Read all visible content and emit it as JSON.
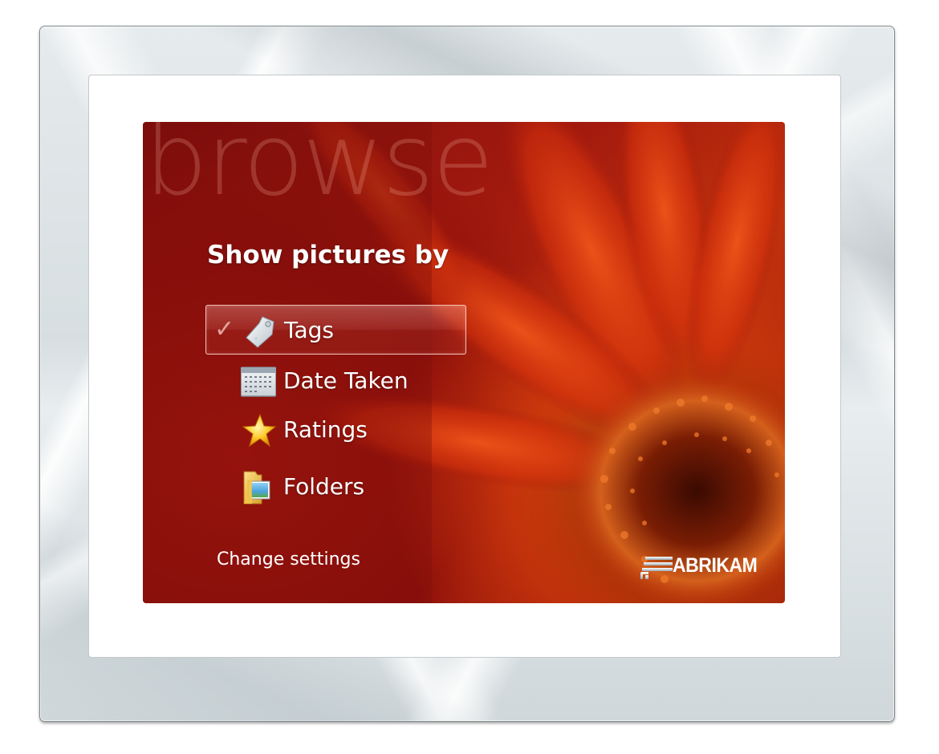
{
  "screen": {
    "watermark": "browse",
    "heading": "Show pictures by"
  },
  "menu": {
    "items": [
      {
        "label": "Tags",
        "icon": "tag-icon",
        "selected": true,
        "check": "✓"
      },
      {
        "label": "Date Taken",
        "icon": "calendar-icon",
        "selected": false
      },
      {
        "label": "Ratings",
        "icon": "star-icon",
        "selected": false
      },
      {
        "label": "Folders",
        "icon": "folder-icon",
        "selected": false
      }
    ]
  },
  "footer": {
    "settings_label": "Change settings",
    "brand_name": "ABRIKAM"
  },
  "colors": {
    "screen_background": "#a31a0e",
    "text": "#ffffff",
    "frame": "#dfe5e7"
  }
}
